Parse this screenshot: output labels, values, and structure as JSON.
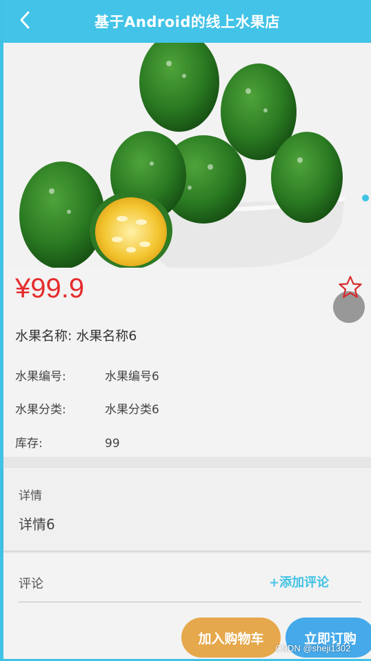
{
  "header": {
    "title": "基于Android的线上水果店",
    "back_icon": "chevron-left-icon"
  },
  "product": {
    "image_alt": "fruit-photo",
    "price": "¥99.9",
    "name_label": "水果名称:",
    "name_value": "水果名称6",
    "fields": [
      {
        "label": "水果编号:",
        "value": "水果编号6"
      },
      {
        "label": "水果分类:",
        "value": "水果分类6"
      },
      {
        "label": "库存:",
        "value": "99"
      }
    ]
  },
  "detail": {
    "label": "详情",
    "text": "详情6"
  },
  "comments": {
    "label": "评论",
    "add_label": "+添加评论"
  },
  "actions": {
    "cart_label": "加入购物车",
    "buy_label": "立即订购"
  },
  "watermark": "CSDN @sheji1302",
  "colors": {
    "accent": "#42c3e7",
    "price": "#e52c2c",
    "cart": "#e6a84c",
    "buy": "#45a9ea"
  }
}
